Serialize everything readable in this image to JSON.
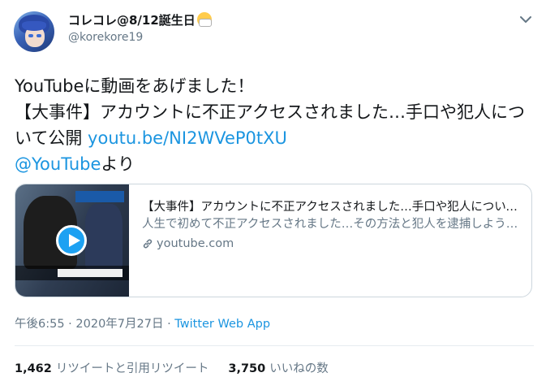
{
  "user": {
    "display_name": "コレコレ@8/12誕生日",
    "emoji_icon": "face-with-mask",
    "handle": "@korekore19"
  },
  "tweet": {
    "line1": "YouTubeに動画をあげました！",
    "line2_prefix": "【大事件】アカウントに不正アクセスされました…手口や犯人について公開 ",
    "link": "youtu.be/NI2WVeP0tXU",
    "mention": "@YouTube",
    "suffix": "より"
  },
  "card": {
    "title": "【大事件】アカウントに不正アクセスされました…手口や犯人について公開",
    "description": "人生で初めて不正アクセスされました…その方法と犯人を逮捕しようと動いてみた 【神回】荒野行動をニャンちゅう4人と…",
    "domain": "youtube.com"
  },
  "meta": {
    "time": "午後6:55 · 2020年7月27日 · ",
    "source": "Twitter Web App"
  },
  "stats": {
    "retweets_count": "1,462",
    "retweets_label": "リツイートと引用リツイート",
    "likes_count": "3,750",
    "likes_label": "いいねの数"
  },
  "colors": {
    "link": "#1b95e0",
    "secondary_text": "#657786",
    "primary_text": "#14171a",
    "border": "#ccd6dd"
  }
}
